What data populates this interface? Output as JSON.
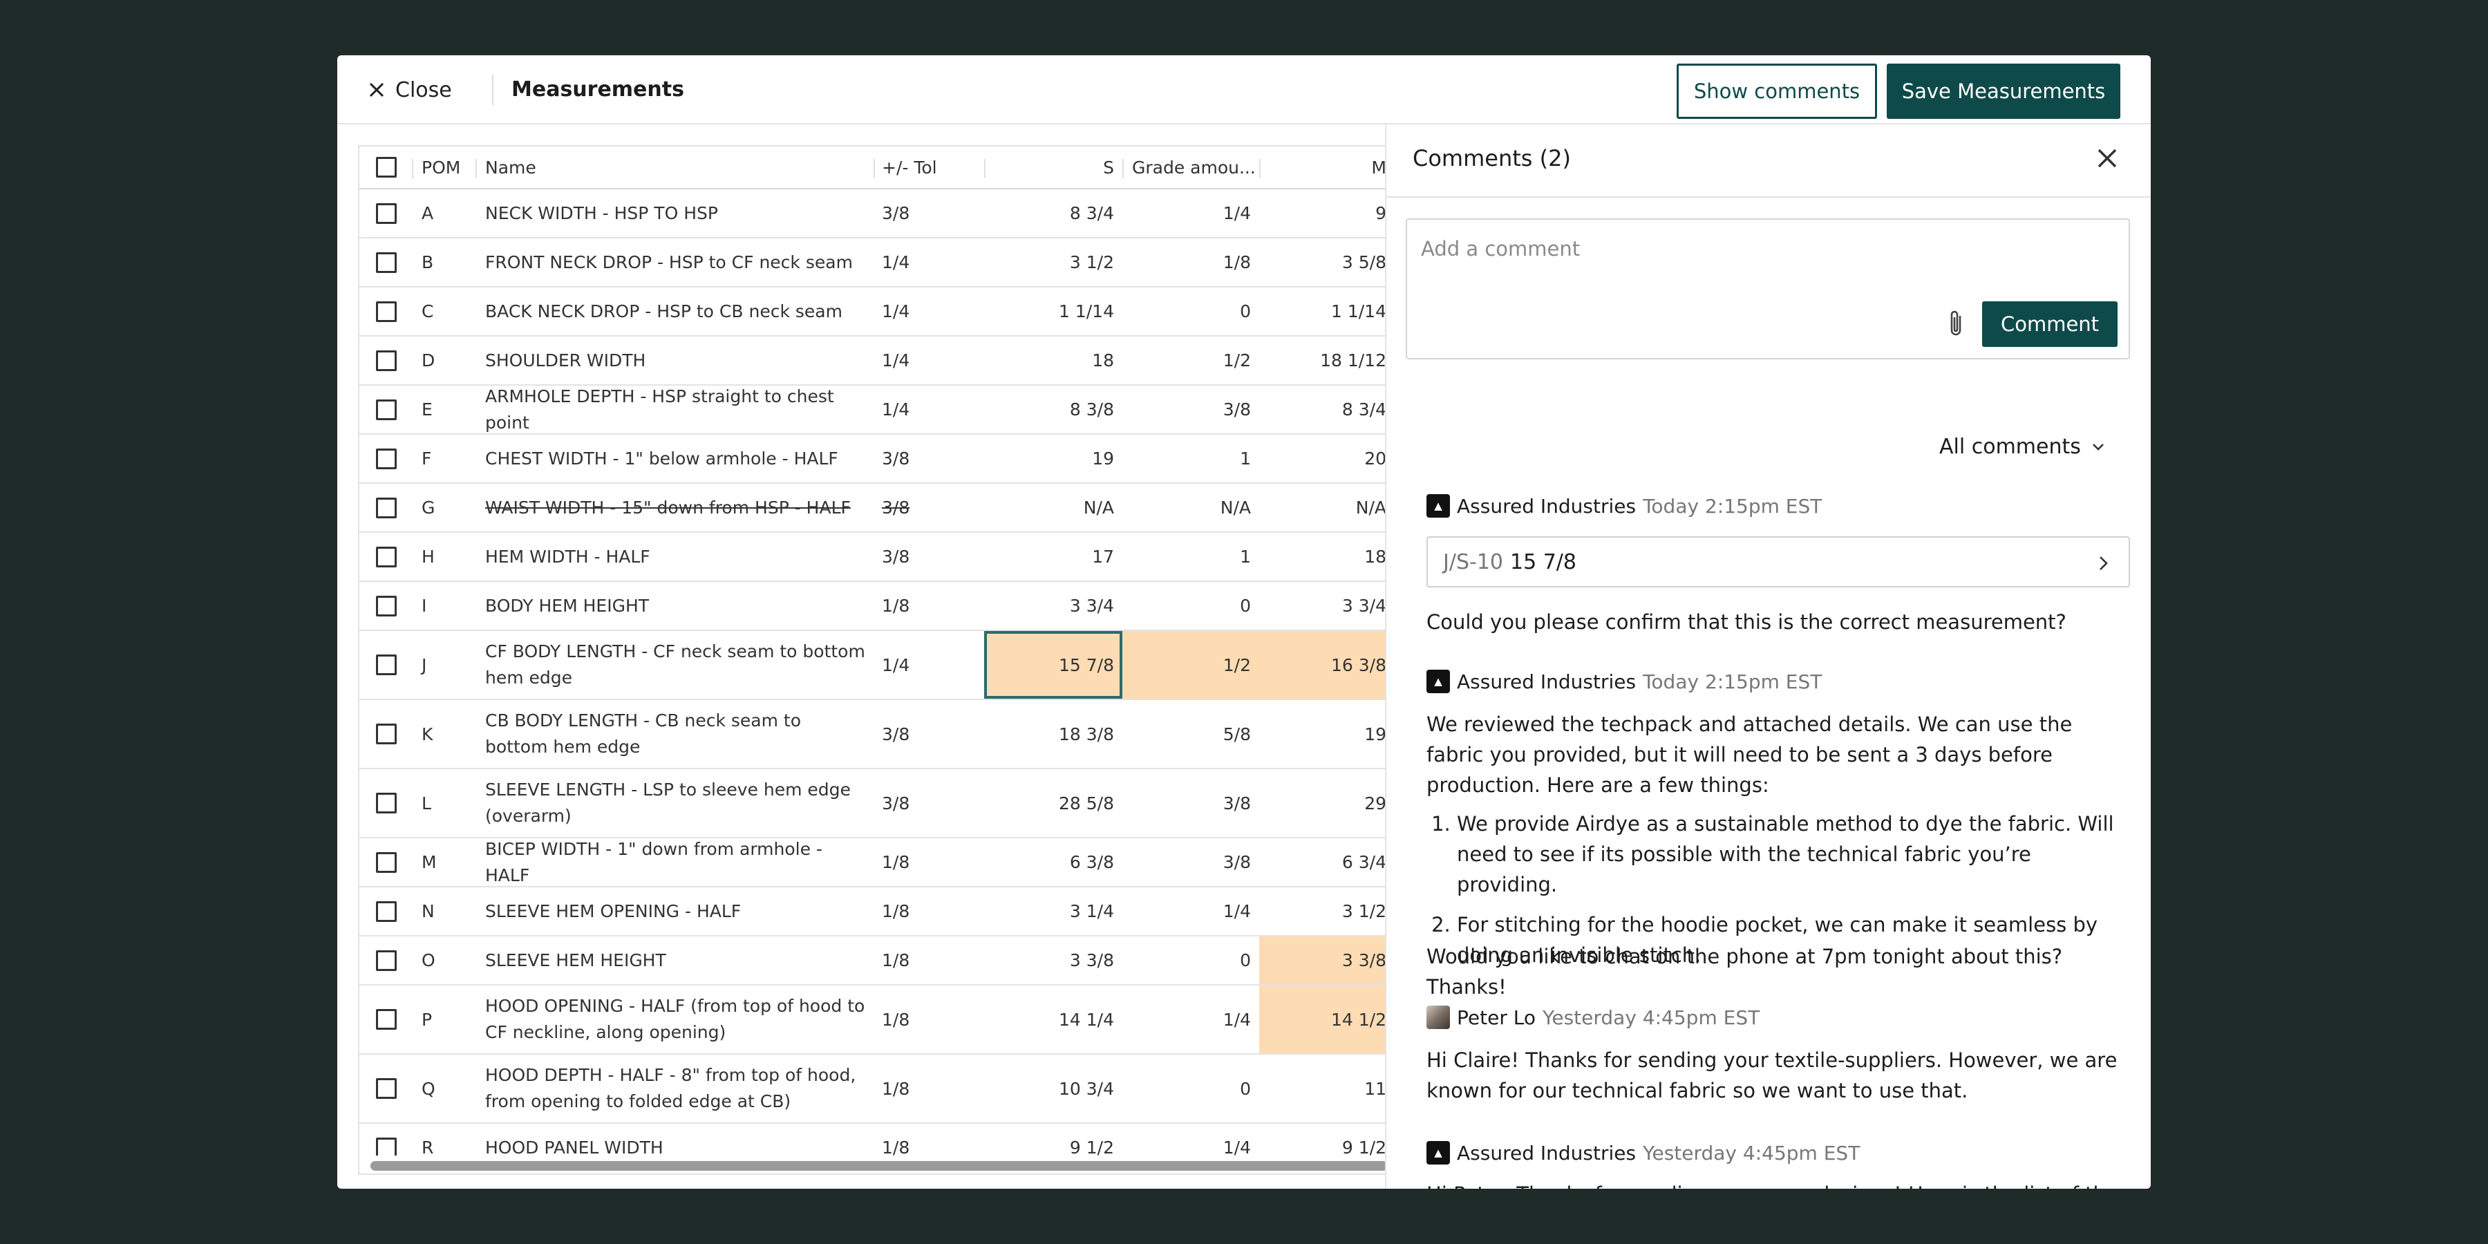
{
  "header": {
    "close_label": "Close",
    "title": "Measurements",
    "show_comments": "Show comments",
    "save": "Save Measurements"
  },
  "table": {
    "columns": [
      "POM",
      "Name",
      "+/- Tol",
      "S",
      "Grade amou...",
      "M"
    ],
    "rows": [
      {
        "pom": "A",
        "name": "NECK WIDTH - HSP TO HSP",
        "tol": "3/8",
        "s": "8 3/4",
        "grade": "1/4",
        "m": "9"
      },
      {
        "pom": "B",
        "name": "FRONT NECK DROP - HSP to CF neck seam",
        "tol": "1/4",
        "s": "3 1/2",
        "grade": "1/8",
        "m": "3 5/8"
      },
      {
        "pom": "C",
        "name": "BACK NECK DROP - HSP to CB neck seam",
        "tol": "1/4",
        "s": "1 1/14",
        "grade": "0",
        "m": "1 1/14"
      },
      {
        "pom": "D",
        "name": "SHOULDER WIDTH",
        "tol": "1/4",
        "s": "18",
        "grade": "1/2",
        "m": "18 1/12"
      },
      {
        "pom": "E",
        "name": "ARMHOLE DEPTH - HSP straight to chest point",
        "tol": "1/4",
        "s": "8 3/8",
        "grade": "3/8",
        "m": "8 3/4"
      },
      {
        "pom": "F",
        "name": "CHEST WIDTH - 1\" below armhole - HALF",
        "tol": "3/8",
        "s": "19",
        "grade": "1",
        "m": "20"
      },
      {
        "pom": "G",
        "name": "WAIST WIDTH - 15\" down from HSP - HALF",
        "tol": "3/8",
        "s": "N/A",
        "grade": "N/A",
        "m": "N/A"
      },
      {
        "pom": "H",
        "name": "HEM WIDTH - HALF",
        "tol": "3/8",
        "s": "17",
        "grade": "1",
        "m": "18"
      },
      {
        "pom": "I",
        "name": "BODY HEM HEIGHT",
        "tol": "1/8",
        "s": "3 3/4",
        "grade": "0",
        "m": "3 3/4"
      },
      {
        "pom": "J",
        "name": "CF BODY LENGTH - CF neck seam to bottom hem edge",
        "tol": "1/4",
        "s": "15 7/8",
        "grade": "1/2",
        "m": "16 3/8"
      },
      {
        "pom": "K",
        "name": "CB BODY LENGTH - CB neck seam to bottom hem edge",
        "tol": "3/8",
        "s": "18 3/8",
        "grade": "5/8",
        "m": "19"
      },
      {
        "pom": "L",
        "name": "SLEEVE LENGTH - LSP to sleeve hem edge (overarm)",
        "tol": "3/8",
        "s": "28 5/8",
        "grade": "3/8",
        "m": "29"
      },
      {
        "pom": "M",
        "name": "BICEP WIDTH - 1\" down from armhole - HALF",
        "tol": "1/8",
        "s": "6 3/8",
        "grade": "3/8",
        "m": "6 3/4"
      },
      {
        "pom": "N",
        "name": "SLEEVE HEM OPENING - HALF",
        "tol": "1/8",
        "s": "3 1/4",
        "grade": "1/4",
        "m": "3 1/2"
      },
      {
        "pom": "O",
        "name": "SLEEVE HEM HEIGHT",
        "tol": "1/8",
        "s": "3 3/8",
        "grade": "0",
        "m": "3 3/8"
      },
      {
        "pom": "P",
        "name": "HOOD OPENING - HALF (from top of hood to CF neckline, along opening)",
        "tol": "1/8",
        "s": "14 1/4",
        "grade": "1/4",
        "m": "14 1/2"
      },
      {
        "pom": "Q",
        "name": "HOOD DEPTH - HALF - 8\" from top of hood, from opening to folded edge at CB)",
        "tol": "1/8",
        "s": "10 3/4",
        "grade": "0",
        "m": "11"
      },
      {
        "pom": "R",
        "name": "HOOD PANEL WIDTH",
        "tol": "1/8",
        "s": "9 1/2",
        "grade": "1/4",
        "m": "9 1/2"
      }
    ],
    "highlight_color": "#fddcb4",
    "selected_cell": "J/S"
  },
  "comments": {
    "title": "Comments (2)",
    "input_placeholder": "Add a comment",
    "comment_button": "Comment",
    "filter_label": "All comments",
    "thread": [
      {
        "author": "Assured Industries",
        "time": "Today 2:15pm EST",
        "ref_code": "J/S-10",
        "ref_value": "15 7/8",
        "text": "Could you please confirm that this is the correct measurement?"
      },
      {
        "author": "Assured Industries",
        "time": "Today 2:15pm EST",
        "text": "We reviewed the techpack and attached details. We can use the fabric you provided, but it will need to be sent a 3 days before production. Here are a few things:",
        "list": [
          "We provide Airdye as a sustainable method to dye the fabric. Will need to see if its possible with the technical fabric you’re providing.",
          "For stitching for the hoodie pocket, we can make it seamless by doing an invisible stitch."
        ],
        "closing": "Would you like to chat on the phone at 7pm tonight about this? Thanks!"
      },
      {
        "author": "Peter Lo",
        "time": "Yesterday 4:45pm EST",
        "text": "Hi Claire! Thanks for sending your textile-suppliers. However, we are known for our technical fabric so we want to use that."
      },
      {
        "author": "Assured Industries",
        "time": "Yesterday 4:45pm EST",
        "text": "Hi Peter. Thanks for sending over your designs! Here is the list of the textile suppliers so we can offer you a better price."
      }
    ],
    "accent_color": "#0e4a4a"
  }
}
